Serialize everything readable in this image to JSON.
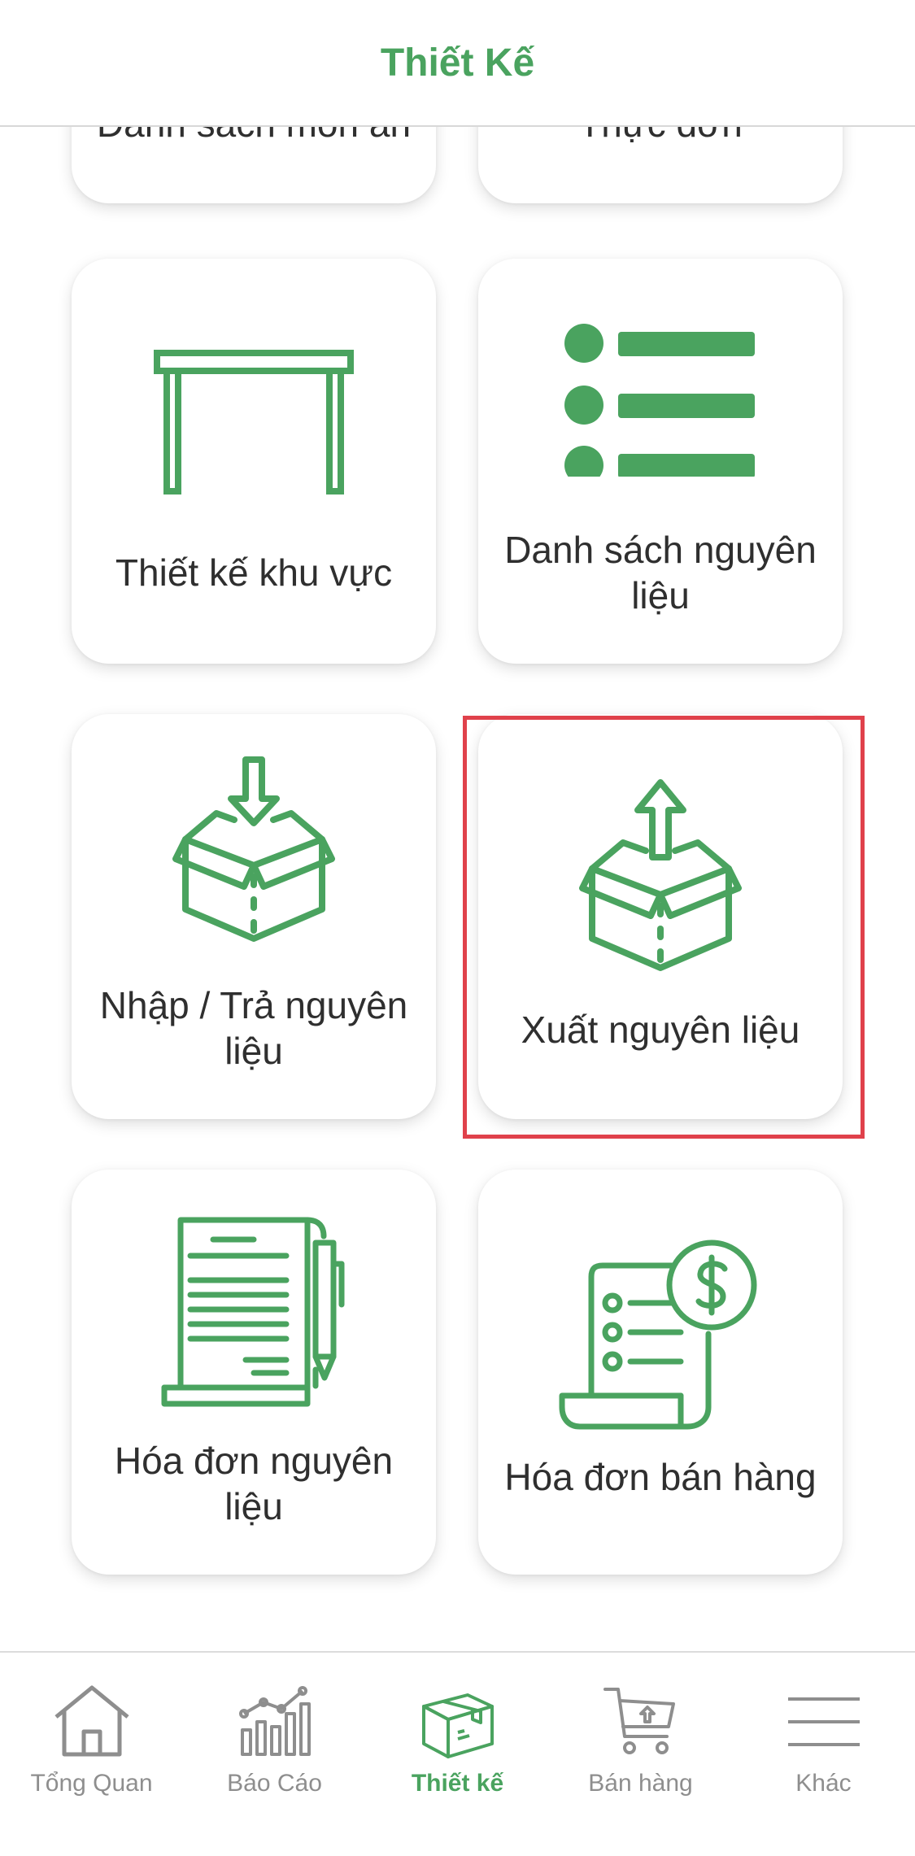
{
  "header": {
    "title": "Thiết Kế"
  },
  "cards": {
    "partial_left": {
      "label": "Danh sách món ăn",
      "icon": "dish-list-icon"
    },
    "partial_right": {
      "label": "Thực đơn",
      "icon": "menu-icon"
    },
    "area_design": {
      "label": "Thiết kế khu vực",
      "icon": "table-icon"
    },
    "ingredient_list": {
      "label": "Danh sách nguyên liệu",
      "icon": "list-icon"
    },
    "import_return": {
      "label": "Nhập / Trả nguyên liệu",
      "icon": "box-in-icon"
    },
    "export": {
      "label": "Xuất nguyên liệu",
      "icon": "box-out-icon"
    },
    "ingredient_invoice": {
      "label": "Hóa đơn nguyên liệu",
      "icon": "document-pen-icon"
    },
    "sales_invoice": {
      "label": "Hóa đơn bán hàng",
      "icon": "receipt-dollar-icon"
    }
  },
  "tabbar": {
    "items": [
      {
        "label": "Tổng Quan",
        "icon": "home-icon",
        "active": false
      },
      {
        "label": "Báo Cáo",
        "icon": "chart-icon",
        "active": false
      },
      {
        "label": "Thiết kế",
        "icon": "box-icon",
        "active": true
      },
      {
        "label": "Bán hàng",
        "icon": "cart-icon",
        "active": false
      },
      {
        "label": "Khác",
        "icon": "hamburger-icon",
        "active": false
      }
    ]
  },
  "colors": {
    "accent": "#4aa35f",
    "highlight": "#e0414b",
    "inactive": "#8e8e8e",
    "text": "#2f2f2f"
  }
}
